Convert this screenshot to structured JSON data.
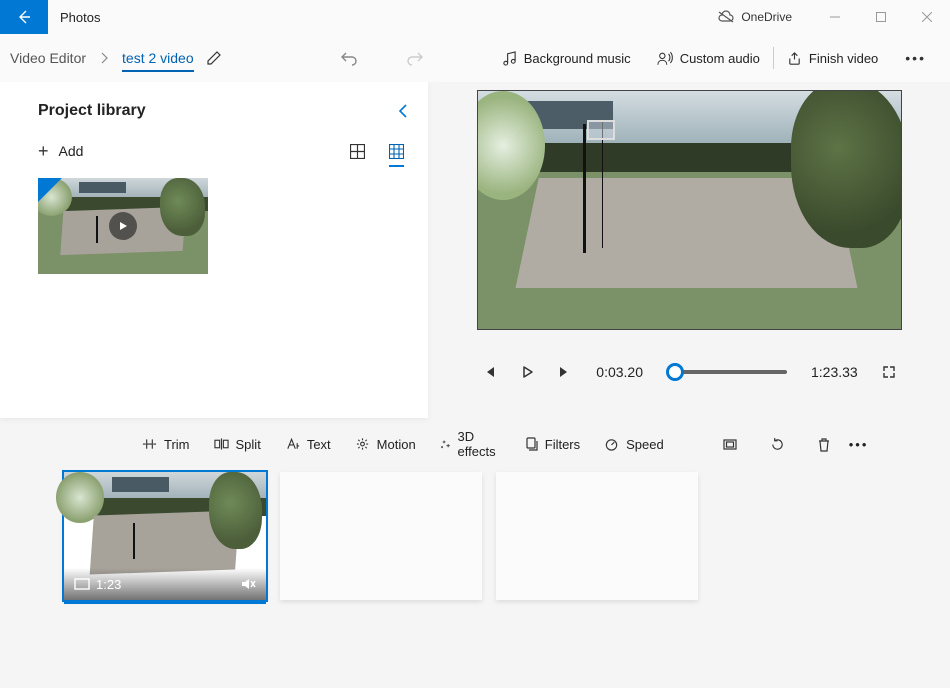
{
  "titlebar": {
    "app_name": "Photos",
    "cloud_label": "OneDrive"
  },
  "breadcrumb": {
    "root": "Video Editor",
    "project": "test 2 video"
  },
  "topcmds": {
    "background_music": "Background music",
    "custom_audio": "Custom audio",
    "finish_video": "Finish video"
  },
  "library": {
    "title": "Project library",
    "add_label": "Add"
  },
  "player": {
    "current_time": "0:03.20",
    "total_time": "1:23.33"
  },
  "toolbar": {
    "trim": "Trim",
    "split": "Split",
    "text": "Text",
    "motion": "Motion",
    "effects3d": "3D effects",
    "filters": "Filters",
    "speed": "Speed"
  },
  "clip": {
    "duration_label": "1:23"
  }
}
